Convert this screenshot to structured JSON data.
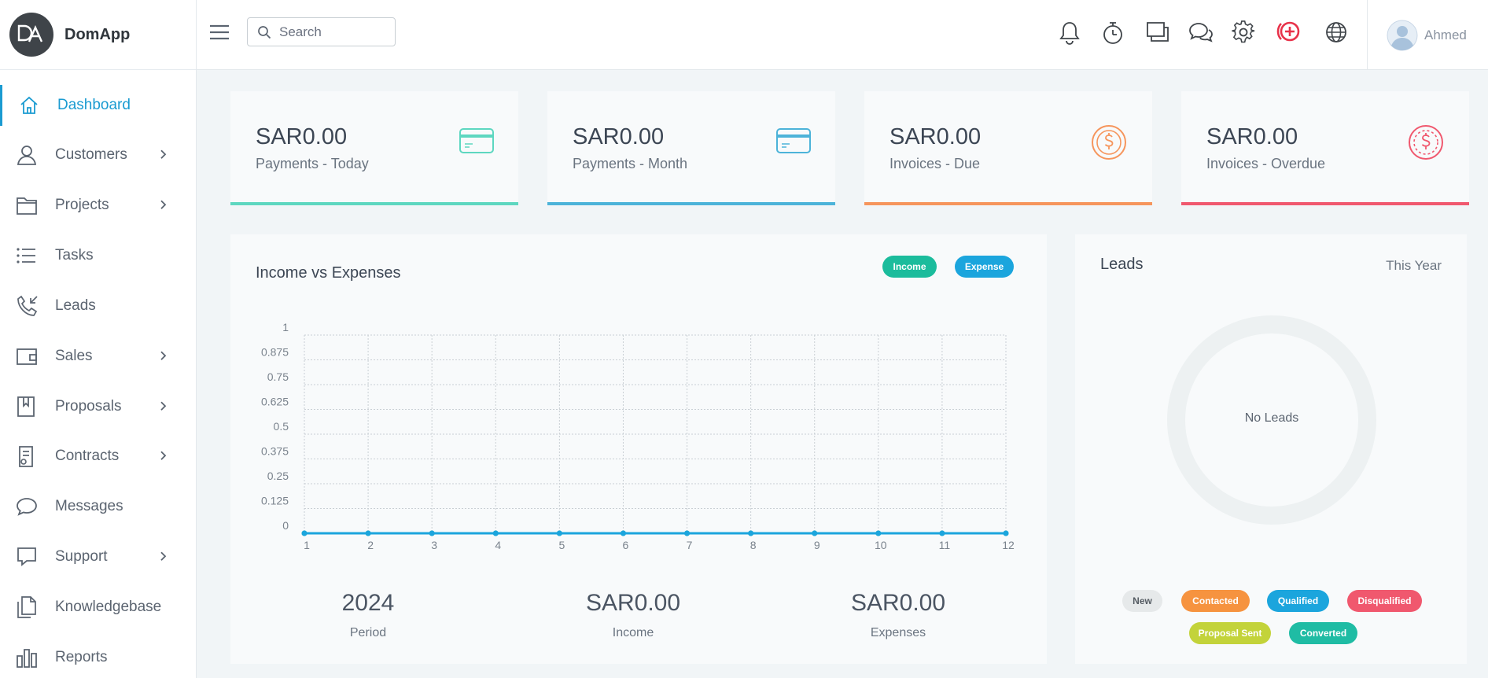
{
  "brand": {
    "name": "DomApp",
    "logo_text": "DA"
  },
  "sidebar": {
    "items": [
      {
        "label": "Dashboard",
        "icon": "home-icon",
        "active": true
      },
      {
        "label": "Customers",
        "icon": "users-icon",
        "has_submenu": true
      },
      {
        "label": "Projects",
        "icon": "folder-icon",
        "has_submenu": true
      },
      {
        "label": "Tasks",
        "icon": "list-icon"
      },
      {
        "label": "Leads",
        "icon": "phone-incoming-icon"
      },
      {
        "label": "Sales",
        "icon": "wallet-icon",
        "has_submenu": true
      },
      {
        "label": "Proposals",
        "icon": "book-icon",
        "has_submenu": true
      },
      {
        "label": "Contracts",
        "icon": "contract-icon",
        "has_submenu": true
      },
      {
        "label": "Messages",
        "icon": "chat-icon"
      },
      {
        "label": "Support",
        "icon": "support-icon",
        "has_submenu": true
      },
      {
        "label": "Knowledgebase",
        "icon": "documents-icon"
      },
      {
        "label": "Reports",
        "icon": "bar-chart-icon"
      }
    ]
  },
  "topbar": {
    "search_placeholder": "Search",
    "user_name": "Ahmed",
    "icons": [
      "bell-icon",
      "timer-icon",
      "windows-icon",
      "chat-bubbles-icon",
      "gear-icon",
      "add-circle-icon",
      "globe-icon"
    ]
  },
  "cards": [
    {
      "amount": "SAR0.00",
      "label": "Payments - Today",
      "color": "#5dd7c0",
      "icon": "credit-card-icon"
    },
    {
      "amount": "SAR0.00",
      "label": "Payments - Month",
      "color": "#4cb3d9",
      "icon": "credit-card-icon"
    },
    {
      "amount": "SAR0.00",
      "label": "Invoices - Due",
      "color": "#f6955c",
      "icon": "dollar-coin-icon"
    },
    {
      "amount": "SAR0.00",
      "label": "Invoices - Overdue",
      "color": "#f0586e",
      "icon": "dollar-coin-icon"
    }
  ],
  "income_chart": {
    "title": "Income vs Expenses",
    "legend": [
      {
        "label": "Income",
        "color": "#1bbc9c"
      },
      {
        "label": "Expense",
        "color": "#1ba5dd"
      }
    ]
  },
  "chart_data": {
    "type": "line",
    "title": "Income vs Expenses",
    "x": [
      1,
      2,
      3,
      4,
      5,
      6,
      7,
      8,
      9,
      10,
      11,
      12
    ],
    "y_ticks": [
      "0",
      "0.125",
      "0.25",
      "0.375",
      "0.5",
      "0.625",
      "0.75",
      "0.875",
      "1"
    ],
    "ylim": [
      0,
      1
    ],
    "series": [
      {
        "name": "Income",
        "values": [
          0,
          0,
          0,
          0,
          0,
          0,
          0,
          0,
          0,
          0,
          0,
          0
        ]
      },
      {
        "name": "Expense",
        "values": [
          0,
          0,
          0,
          0,
          0,
          0,
          0,
          0,
          0,
          0,
          0,
          0
        ]
      }
    ],
    "grid": true,
    "legend_position": "top-right"
  },
  "summary": [
    {
      "value": "2024",
      "label": "Period"
    },
    {
      "value": "SAR0.00",
      "label": "Income"
    },
    {
      "value": "SAR0.00",
      "label": "Expenses"
    }
  ],
  "leads": {
    "title": "Leads",
    "period": "This Year",
    "empty_text": "No Leads",
    "statuses": [
      {
        "label": "New",
        "bg": "#e6e9ea",
        "fg": "#555c63"
      },
      {
        "label": "Contacted",
        "bg": "#f6933f",
        "fg": "#ffffff"
      },
      {
        "label": "Qualified",
        "bg": "#1ba5dd",
        "fg": "#ffffff"
      },
      {
        "label": "Disqualified",
        "bg": "#f0586e",
        "fg": "#ffffff"
      },
      {
        "label": "Proposal Sent",
        "bg": "#c3d33a",
        "fg": "#ffffff"
      },
      {
        "label": "Converted",
        "bg": "#1fbca4",
        "fg": "#ffffff"
      }
    ]
  }
}
